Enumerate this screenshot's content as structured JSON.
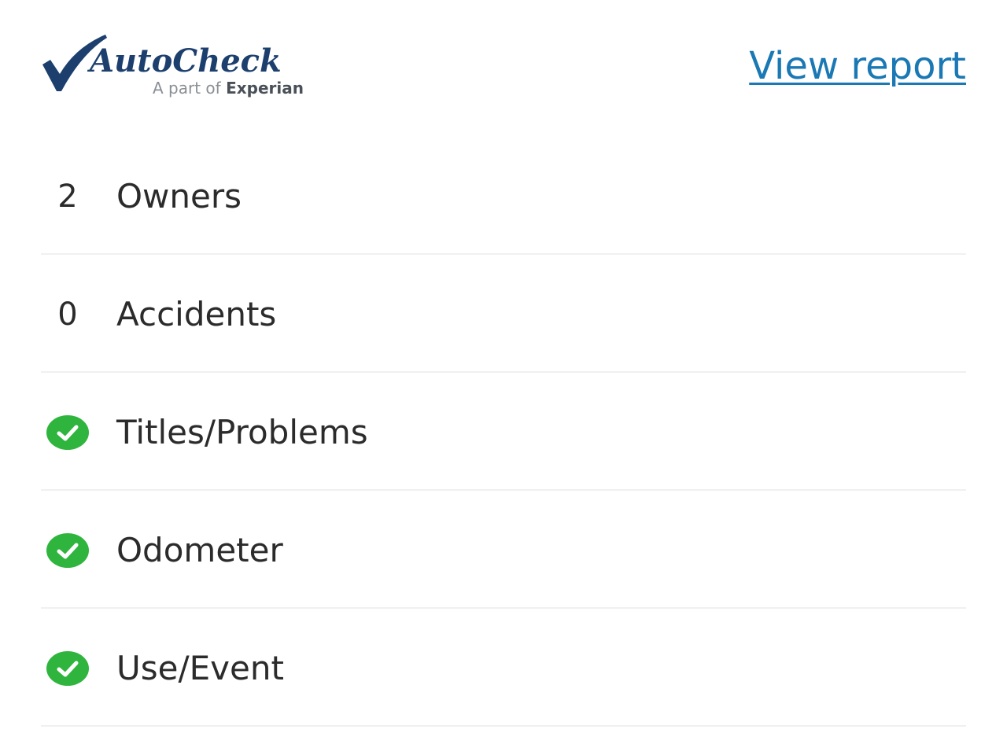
{
  "header": {
    "logo": {
      "wordmark": "AutoCheck",
      "tagline_prefix": "A part of",
      "tagline_brand": "Experian",
      "check_color": "#1c3f6e"
    },
    "view_report_label": "View report",
    "link_color": "#1a78b4"
  },
  "rows": [
    {
      "type": "count",
      "count": "2",
      "label": "Owners"
    },
    {
      "type": "count",
      "count": "0",
      "label": "Accidents"
    },
    {
      "type": "check",
      "icon": "check-circle-icon",
      "label": "Titles/Problems"
    },
    {
      "type": "check",
      "icon": "check-circle-icon",
      "label": "Odometer"
    },
    {
      "type": "check",
      "icon": "check-circle-icon",
      "label": "Use/Event"
    }
  ],
  "colors": {
    "check_green": "#2fb53d",
    "text": "#2b2b2b",
    "divider": "#f0f0f0"
  }
}
